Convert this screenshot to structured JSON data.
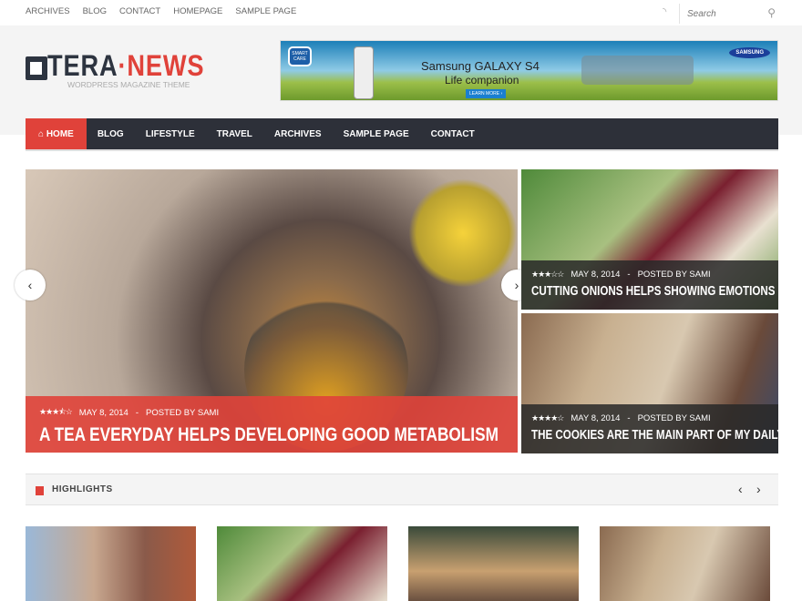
{
  "topbar": {
    "links": [
      "Archives",
      "Blog",
      "Contact",
      "Homepage",
      "Sample Page"
    ],
    "search_placeholder": "Search"
  },
  "logo": {
    "part1": "TERA",
    "dot": "·",
    "part2": "NEWS",
    "tagline": "WORDPRESS MAGAZINE THEME"
  },
  "ad": {
    "title": "Samsung GALAXY S4",
    "subtitle": "Life companion",
    "button": "LEARN MORE ›",
    "brand": "SAMSUNG",
    "badge": "SMART CARE"
  },
  "nav": {
    "items": [
      "Home",
      "Blog",
      "Lifestyle",
      "Travel",
      "Archives",
      "Sample Page",
      "Contact"
    ]
  },
  "slider": {
    "rating": 3.5,
    "stars": "★★★⯪☆",
    "date": "May 8, 2014",
    "sep": "-",
    "author": "Posted by Sami",
    "title": "A Tea Everyday Helps Developing Good Metabolism",
    "prev": "‹",
    "next": "›"
  },
  "side_posts": [
    {
      "rating": 3,
      "stars": "★★★☆☆",
      "date": "May 8, 2014",
      "sep": "-",
      "author": "Posted by Sami",
      "title": "Cutting Onions Helps Showing Emotions"
    },
    {
      "rating": 4,
      "stars": "★★★★☆",
      "date": "May 8, 2014",
      "sep": "-",
      "author": "Posted by Sami",
      "title": "The Cookies Are The Main Part Of My Daily Life"
    }
  ],
  "highlights": {
    "title": "HIGHLIGHTS",
    "prev": "‹",
    "next": "›"
  },
  "colors": {
    "accent": "#e0423a",
    "nav": "#2d3039"
  }
}
